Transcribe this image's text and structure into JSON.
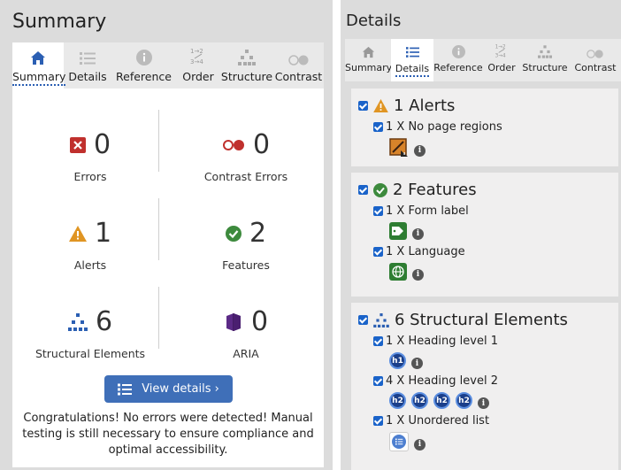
{
  "summary_panel": {
    "title": "Summary",
    "tabs": [
      {
        "label": "Summary",
        "icon": "home-icon",
        "active": true
      },
      {
        "label": "Details",
        "icon": "list-icon",
        "active": false
      },
      {
        "label": "Reference",
        "icon": "info-icon",
        "active": false
      },
      {
        "label": "Order",
        "icon": "order-icon",
        "active": false
      },
      {
        "label": "Structure",
        "icon": "structure-icon",
        "active": false
      },
      {
        "label": "Contrast",
        "icon": "contrast-icon",
        "active": false
      }
    ],
    "stats": {
      "errors": {
        "count": "0",
        "label": "Errors"
      },
      "contrast_errors": {
        "count": "0",
        "label": "Contrast Errors"
      },
      "alerts": {
        "count": "1",
        "label": "Alerts"
      },
      "features": {
        "count": "2",
        "label": "Features"
      },
      "structural": {
        "count": "6",
        "label": "Structural Elements"
      },
      "aria": {
        "count": "0",
        "label": "ARIA"
      }
    },
    "view_details_label": "View details ›",
    "congrats": "Congratulations! No errors were detected! Manual testing is still necessary to ensure compliance and optimal accessibility."
  },
  "details_panel": {
    "title": "Details",
    "tabs": [
      {
        "label": "Summary",
        "active": false
      },
      {
        "label": "Details",
        "active": true
      },
      {
        "label": "Reference",
        "active": false
      },
      {
        "label": "Order",
        "active": false
      },
      {
        "label": "Structure",
        "active": false
      },
      {
        "label": "Contrast",
        "active": false
      }
    ],
    "groups": {
      "alerts": {
        "title": "1 Alerts",
        "items": [
          {
            "label": "1 X No page regions"
          }
        ]
      },
      "features": {
        "title": "2 Features",
        "items": [
          {
            "label": "1 X Form label"
          },
          {
            "label": "1 X Language"
          }
        ]
      },
      "structural": {
        "title": "6 Structural Elements",
        "items": [
          {
            "label": "1 X Heading level 1",
            "badges": [
              "h1"
            ]
          },
          {
            "label": "4 X Heading level 2",
            "badges": [
              "h2",
              "h2",
              "h2",
              "h2"
            ]
          },
          {
            "label": "1 X Unordered list"
          }
        ]
      }
    },
    "info_glyph": "i"
  },
  "colors": {
    "accent": "#3f6fb8",
    "error": "#c0302d",
    "alert": "#e09523",
    "feature": "#3d8a3d",
    "structure": "#2b5fb3",
    "aria": "#5b2a86"
  }
}
